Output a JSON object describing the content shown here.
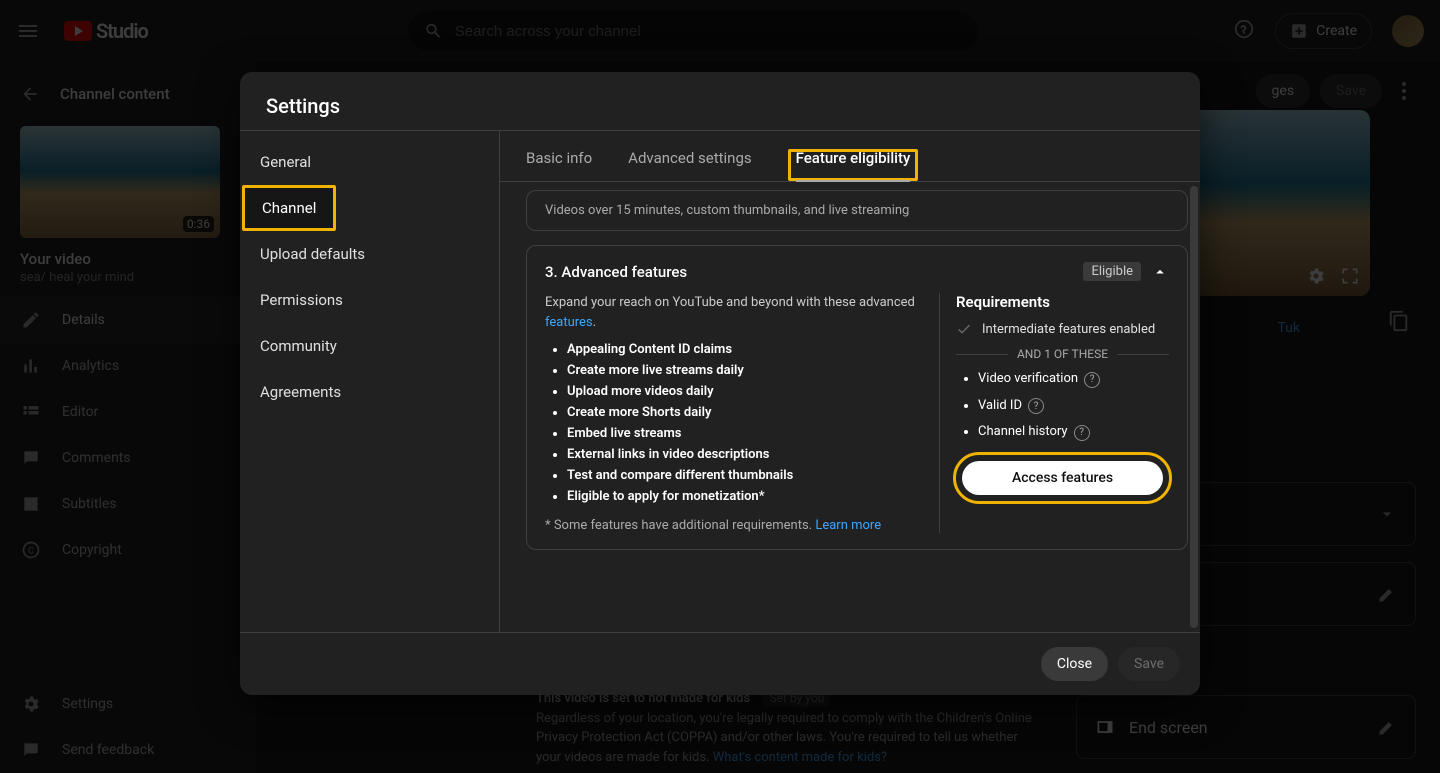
{
  "header": {
    "logo_text": "Studio",
    "search_placeholder": "Search across your channel",
    "create_label": "Create"
  },
  "sidebar_back": "Channel content",
  "video": {
    "duration": "0:36",
    "your_video_label": "Your video",
    "title": "sea/ heal your mind"
  },
  "nav": {
    "details": "Details",
    "analytics": "Analytics",
    "editor": "Editor",
    "comments": "Comments",
    "subtitles": "Subtitles",
    "copyright": "Copyright",
    "settings": "Settings",
    "feedback": "Send feedback"
  },
  "content_right": {
    "undo_changes": "ges",
    "save": "Save",
    "tuk": "Tuk",
    "end_screen": "End screen"
  },
  "disclaimer": {
    "title": "This video is set to not made for kids",
    "set_by": "Set by you",
    "body": "Regardless of your location, you're legally required to comply with the Children's Online Privacy Protection Act (COPPA) and/or other laws. You're required to tell us whether your videos are made for kids. ",
    "link": "What's content made for kids?"
  },
  "modal": {
    "title": "Settings",
    "sidebar": {
      "general": "General",
      "channel": "Channel",
      "upload_defaults": "Upload defaults",
      "permissions": "Permissions",
      "community": "Community",
      "agreements": "Agreements"
    },
    "tabs": {
      "basic_info": "Basic info",
      "advanced_settings": "Advanced settings",
      "feature_eligibility": "Feature eligibility"
    },
    "intermediate_desc": "Videos over 15 minutes, custom thumbnails, and live streaming",
    "adv": {
      "title": "3. Advanced features",
      "eligible": "Eligible",
      "desc_pre": "Expand your reach on YouTube and beyond with these advanced ",
      "desc_link": "features",
      "list": [
        "Appealing Content ID claims",
        "Create more live streams daily",
        "Upload more videos daily",
        "Create more Shorts daily",
        "Embed live streams",
        "External links in video descriptions",
        "Test and compare different thumbnails",
        "Eligible to apply for monetization*"
      ],
      "footnote_pre": "* Some features have additional requirements. ",
      "footnote_link": "Learn more",
      "requirements_title": "Requirements",
      "req_intermediate": "Intermediate features enabled",
      "and_text": "AND 1 OF THESE",
      "req_list": [
        "Video verification",
        "Valid ID",
        "Channel history"
      ],
      "access_btn": "Access features"
    },
    "close": "Close",
    "save": "Save"
  }
}
